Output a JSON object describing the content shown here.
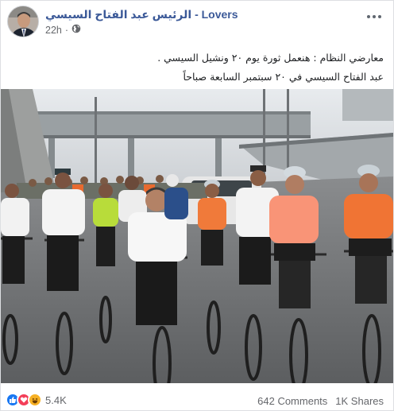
{
  "post": {
    "page_name": "الرئيس عبد الفتاح السيسي - Lovers",
    "timestamp": "22h",
    "privacy_icon": "globe-icon",
    "text_line1": "معارضي النظام : هنعمل ثورة يوم ٢٠ ونشيل السيسي .",
    "text_line2": "عبد الفتاح السيسي في ٢٠ سبتمبر السابعة صباحاً"
  },
  "footer": {
    "reaction_icons": [
      "like-icon",
      "love-icon",
      "haha-icon"
    ],
    "reaction_count": "5.4K",
    "comments": "642 Comments",
    "shares": "1K Shares"
  },
  "colors": {
    "page_name": "#3b5998",
    "meta": "#65676b",
    "like": "#1877f2",
    "love": "#f33e58",
    "haha": "#f7b125"
  }
}
